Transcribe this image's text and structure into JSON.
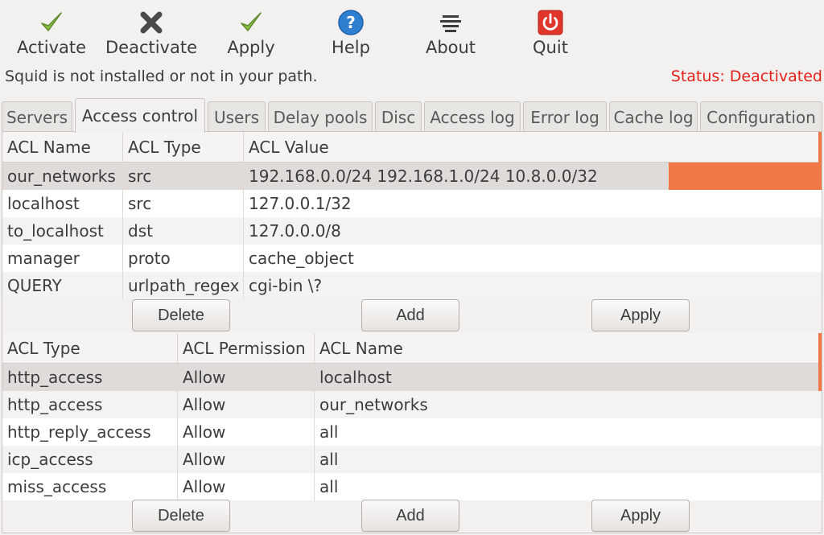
{
  "toolbar": {
    "activate": "Activate",
    "deactivate": "Deactivate",
    "apply": "Apply",
    "help": "Help",
    "about": "About",
    "quit": "Quit"
  },
  "status": {
    "message": "Squid is not installed or not in your path.",
    "state": "Status: Deactivated",
    "state_color": "#e5221a"
  },
  "tabs": [
    "Servers",
    "Access control",
    "Users",
    "Delay pools",
    "Disc",
    "Access log",
    "Error log",
    "Cache log",
    "Configuration"
  ],
  "active_tab": "Access control",
  "acl_table": {
    "headers": [
      "ACL Name",
      "ACL Type",
      "ACL Value"
    ],
    "rows": [
      [
        "our_networks",
        "src",
        "192.168.0.0/24 192.168.1.0/24 10.8.0.0/32"
      ],
      [
        "localhost",
        "src",
        "127.0.0.1/32"
      ],
      [
        "to_localhost",
        "dst",
        "127.0.0.0/8"
      ],
      [
        "manager",
        "proto",
        "cache_object"
      ],
      [
        "QUERY",
        "urlpath_regex",
        "cgi-bin \\?"
      ]
    ],
    "selected_row": 0,
    "buttons": {
      "delete": "Delete",
      "add": "Add",
      "apply": "Apply"
    }
  },
  "access_table": {
    "headers": [
      "ACL Type",
      "ACL Permission",
      "ACL Name"
    ],
    "rows": [
      [
        "http_access",
        "Allow",
        "localhost"
      ],
      [
        "http_access",
        "Allow",
        "our_networks"
      ],
      [
        "http_reply_access",
        "Allow",
        "all"
      ],
      [
        "icp_access",
        "Allow",
        "all"
      ],
      [
        "miss_access",
        "Allow",
        "all"
      ]
    ],
    "selected_row": 0,
    "buttons": {
      "delete": "Delete",
      "add": "Add",
      "apply": "Apply"
    }
  },
  "colors": {
    "accent": "#f07746",
    "check_green": "#8bc34a",
    "help_blue": "#2f7fd0",
    "quit_red": "#e0352b"
  }
}
